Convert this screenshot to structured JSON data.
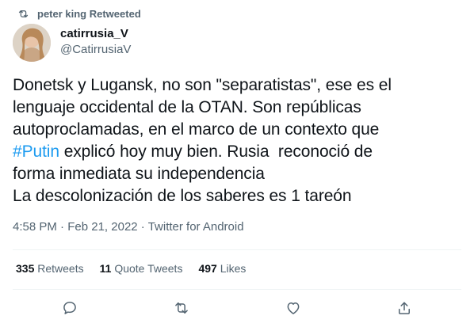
{
  "retweet_context": {
    "text": "peter king Retweeted",
    "icon": "retweet-icon"
  },
  "author": {
    "display_name": "catirrusia_V",
    "handle": "@CatirrusiaV"
  },
  "tweet": {
    "line1": "Donetsk y Lugansk, no son \"separatistas\", ese es el",
    "line2": "lenguaje occidental de la OTAN. Son repúblicas",
    "line3": "autoproclamadas, en el marco de un contexto que",
    "hashtag": "#Putin",
    "line4_rest": " explicó hoy muy bien. Rusia  reconoció de",
    "line5": "forma inmediata su independencia",
    "line6": "La descolonización de los saberes es 1 tareón"
  },
  "meta": {
    "time": "4:58 PM",
    "separator1": " · ",
    "date": "Feb 21, 2022",
    "separator2": " · ",
    "source": "Twitter for Android"
  },
  "stats": {
    "retweets_count": "335",
    "retweets_label": "Retweets",
    "quote_count": "11",
    "quote_label": "Quote Tweets",
    "likes_count": "497",
    "likes_label": "Likes"
  },
  "actions": {
    "reply_icon": "reply-icon",
    "retweet_icon": "retweet-icon",
    "like_icon": "heart-icon",
    "share_icon": "share-icon"
  },
  "colors": {
    "text": "#0f1419",
    "secondary": "#536471",
    "link": "#1d9bf0",
    "divider": "#eff3f4"
  }
}
